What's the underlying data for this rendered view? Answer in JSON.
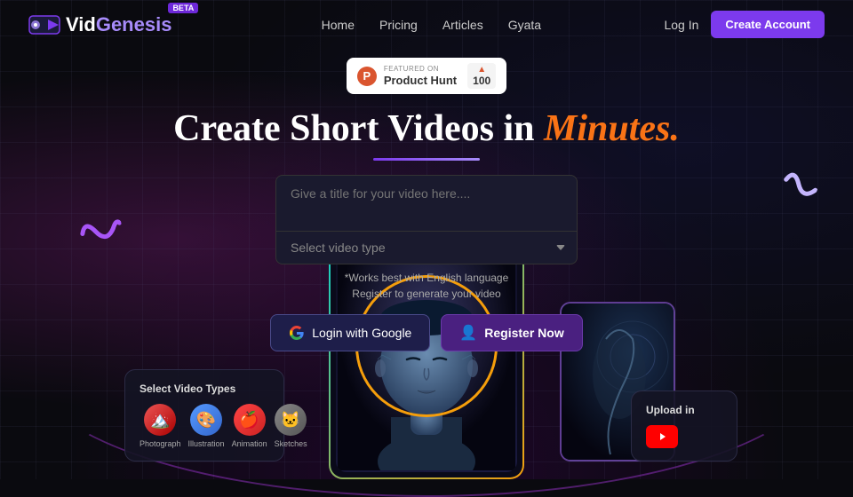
{
  "brand": {
    "name_vid": "Vid",
    "name_genesis": "Genesis",
    "beta_label": "BETA"
  },
  "navbar": {
    "links": [
      "Home",
      "Pricing",
      "Articles",
      "Gyata"
    ],
    "login_label": "Log In",
    "create_label": "Create Account"
  },
  "product_hunt": {
    "featured_text": "FEATURED ON",
    "name": "Product Hunt",
    "score": "100",
    "arrow": "▲"
  },
  "hero": {
    "line1": "Create Short Videos in",
    "line2": "Minutes.",
    "dot": "."
  },
  "form": {
    "title_placeholder": "Give a title for your video here....",
    "type_placeholder": "Select video type",
    "helper": "*Works best with English language",
    "register_hint": "Register to generate your video"
  },
  "buttons": {
    "google_login": "Login with Google",
    "register": "Register Now"
  },
  "video_types": {
    "card_title": "Select Video Types",
    "types": [
      {
        "label": "Photograph",
        "emoji": "🏔️",
        "bg": "#e55"
      },
      {
        "label": "Illustration",
        "emoji": "🎨",
        "bg": "#59f"
      },
      {
        "label": "Animation",
        "emoji": "🍎",
        "bg": "#f44"
      },
      {
        "label": "Sketches",
        "emoji": "😺",
        "bg": "#888"
      }
    ]
  },
  "upload": {
    "title": "Upload in"
  },
  "colors": {
    "accent_purple": "#7c3aed",
    "accent_orange": "#f97316",
    "accent_cyan": "#00d4d4",
    "accent_gold": "#f59e0b",
    "bg_dark": "#0a0a0f"
  }
}
